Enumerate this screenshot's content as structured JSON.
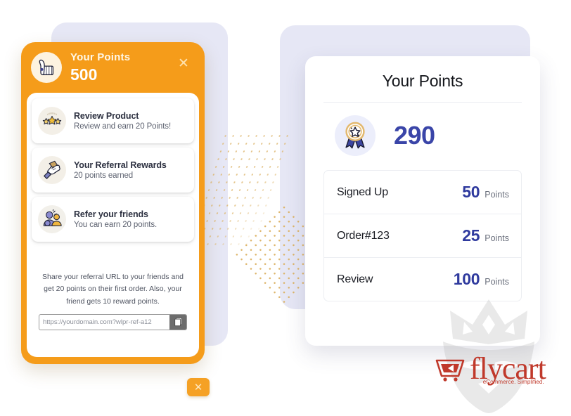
{
  "left_card": {
    "header": {
      "title": "Your Points",
      "points": "500",
      "close_label": "✕",
      "icon": "thumbs-up-icon"
    },
    "items": [
      {
        "icon": "three-stars-icon",
        "title": "Review Product",
        "subtitle": "Review and earn 20 Points!"
      },
      {
        "icon": "handshake-icon",
        "title": "Your Referral Rewards",
        "subtitle": "20 points earned"
      },
      {
        "icon": "refer-friends-icon",
        "title": "Refer your friends",
        "subtitle": "You can earn 20 points."
      }
    ],
    "share": {
      "description": "Share your referral URL to your friends and get 20 points on their first order. Also, your friend gets 10 reward points.",
      "url_value": "https://yourdomain.com?wlpr-ref-a12",
      "url_placeholder": "https://yourdomain.com?wlpr-ref-a12",
      "copy_icon": "copy-icon"
    },
    "fab_close_label": "✕"
  },
  "right_card": {
    "title": "Your Points",
    "total": {
      "icon": "medal-award-icon",
      "value": "290"
    },
    "unit_label": "Points",
    "rows": [
      {
        "label": "Signed Up",
        "value": "50",
        "unit": "Points"
      },
      {
        "label": "Order#123",
        "value": "25",
        "unit": "Points"
      },
      {
        "label": "Review",
        "value": "100",
        "unit": "Points"
      }
    ]
  },
  "branding": {
    "logo_name": "flycart",
    "tagline": "eCommerce. Simplified.",
    "cart_icon": "flycart-cart-icon",
    "watermark_icon": "crowned-mask-watermark"
  },
  "colors": {
    "orange": "#f59c1a",
    "indigo": "#3a45a8",
    "lavender": "#e6e7f5",
    "brand_red": "#c0392b",
    "dot_gold": "#dcb264"
  }
}
